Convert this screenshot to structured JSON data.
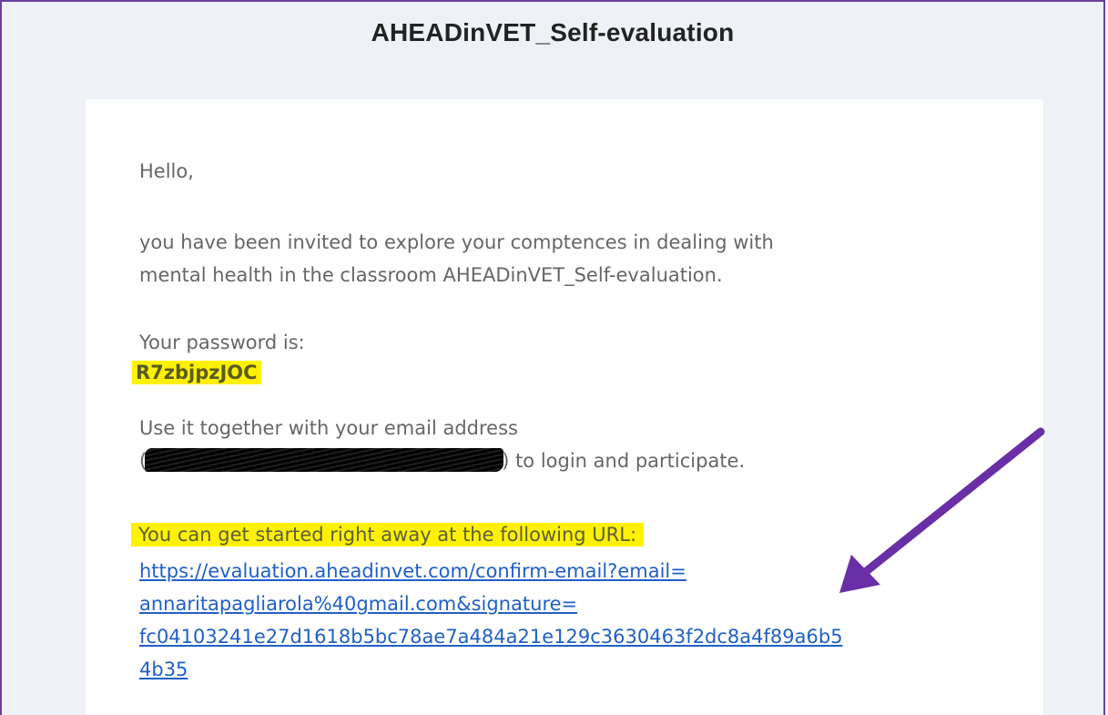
{
  "email": {
    "title": "AHEADinVET_Self-evaluation",
    "greeting": "Hello,",
    "invite_line1": "you have been invited to explore your comptences in dealing with",
    "invite_line2": "mental health in the classroom AHEADinVET_Self-evaluation.",
    "password_label": "Your password is:",
    "password": "R7zbjpzJOC",
    "use_it": "Use it together with your email address",
    "email_open": "(",
    "email_close": ") to login and participate.",
    "cta": "You can get started right away at the following URL:",
    "url_lines": [
      "https://evaluation.aheadinvet.com/confirm-email?email=",
      "annaritapagliarola%40gmail.com&signature=",
      "fc04103241e27d1618b5bc78ae7a484a21e129c3630463f2dc8a4f89a6b5",
      "4b35"
    ]
  },
  "colors": {
    "highlight": "#fff200",
    "link": "#2060c8",
    "annotation_arrow": "#6a2ea6",
    "frame_border": "#6b3fa0",
    "background": "#eef1f5"
  },
  "icons": {
    "annotation": "arrow-icon",
    "redaction": "redaction-scribble"
  }
}
